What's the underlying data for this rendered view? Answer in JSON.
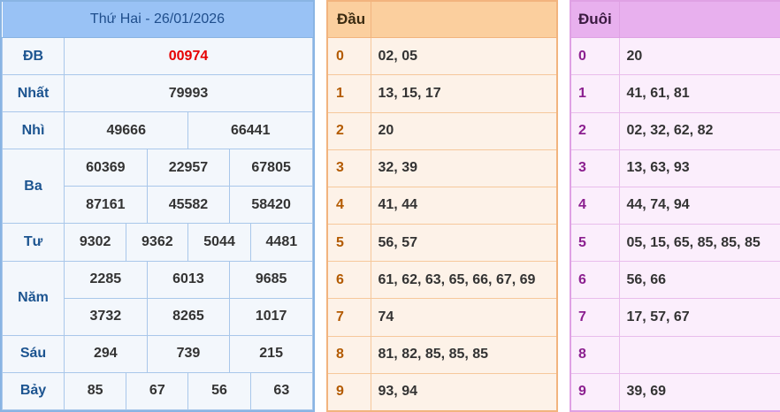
{
  "results": {
    "title": "Thứ Hai - 26/01/2026",
    "rows": [
      {
        "label": "ĐB",
        "values": [
          "00974"
        ]
      },
      {
        "label": "Nhất",
        "values": [
          "79993"
        ]
      },
      {
        "label": "Nhì",
        "values": [
          "49666",
          "66441"
        ]
      },
      {
        "label": "Ba",
        "values": [
          "60369",
          "22957",
          "67805",
          "87161",
          "45582",
          "58420"
        ]
      },
      {
        "label": "Tư",
        "values": [
          "9302",
          "9362",
          "5044",
          "4481"
        ]
      },
      {
        "label": "Năm",
        "values": [
          "2285",
          "6013",
          "9685",
          "3732",
          "8265",
          "1017"
        ]
      },
      {
        "label": "Sáu",
        "values": [
          "294",
          "739",
          "215"
        ]
      },
      {
        "label": "Bảy",
        "values": [
          "85",
          "67",
          "56",
          "63"
        ]
      }
    ]
  },
  "dau": {
    "header": "Đầu",
    "rows": [
      {
        "key": "0",
        "value": "02, 05"
      },
      {
        "key": "1",
        "value": "13, 15, 17"
      },
      {
        "key": "2",
        "value": "20"
      },
      {
        "key": "3",
        "value": "32, 39"
      },
      {
        "key": "4",
        "value": "41, 44"
      },
      {
        "key": "5",
        "value": "56, 57"
      },
      {
        "key": "6",
        "value": "61, 62, 63, 65, 66, 67, 69"
      },
      {
        "key": "7",
        "value": "74"
      },
      {
        "key": "8",
        "value": "81, 82, 85, 85, 85"
      },
      {
        "key": "9",
        "value": "93, 94"
      }
    ]
  },
  "duoi": {
    "header": "Đuôi",
    "rows": [
      {
        "key": "0",
        "value": "20"
      },
      {
        "key": "1",
        "value": "41, 61, 81"
      },
      {
        "key": "2",
        "value": "02, 32, 62, 82"
      },
      {
        "key": "3",
        "value": "13, 63, 93"
      },
      {
        "key": "4",
        "value": "44, 74, 94"
      },
      {
        "key": "5",
        "value": "05, 15, 65, 85, 85, 85"
      },
      {
        "key": "6",
        "value": "56, 66"
      },
      {
        "key": "7",
        "value": "17, 57, 67"
      },
      {
        "key": "8",
        "value": ""
      },
      {
        "key": "9",
        "value": "39, 69"
      }
    ]
  },
  "colors": {
    "special_prize": "#e60000",
    "results_header": "#99c2f5",
    "dau_header": "#fbcf9e",
    "duoi_header": "#e8b0ee"
  }
}
